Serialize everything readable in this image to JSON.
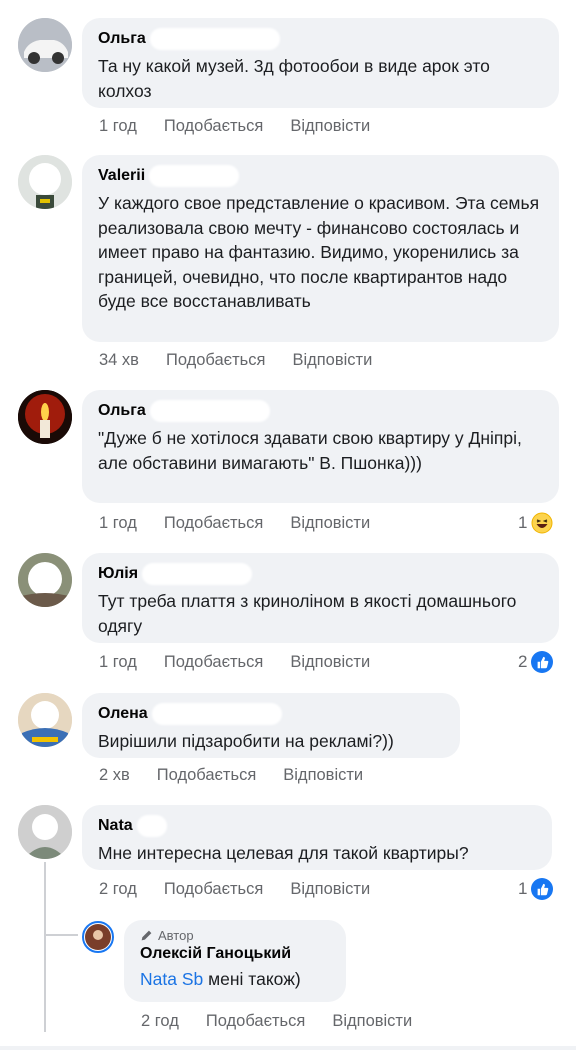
{
  "comments": [
    {
      "author": "Ольга",
      "text": "Та ну какой музей. 3д фотообои в виде арок это колхоз",
      "time": "1 год",
      "like_label": "Подобається",
      "reply_label": "Відповісти"
    },
    {
      "author": "Valerii",
      "text": "У каждого свое представление о красивом. Эта семья реализовала свою мечту - финансово состоялась и имеет право на фантазию. Видимо, укоренились за границей, очевидно, что после квартирантов надо буде все восстанавливать",
      "time": "34 хв",
      "like_label": "Подобається",
      "reply_label": "Відповісти"
    },
    {
      "author": "Ольга",
      "text": "\"Дуже б не хотілося здавати свою квартиру у Дніпрі, але обставини вимагають\" В. Пшонка)))",
      "time": "1 год",
      "like_label": "Подобається",
      "reply_label": "Відповісти",
      "reaction_count": "1",
      "reaction_icon": "haha-icon"
    },
    {
      "author": "Юлія",
      "text": "Тут треба плаття з криноліном в якості домашнього одягу",
      "time": "1 год",
      "like_label": "Подобається",
      "reply_label": "Відповісти",
      "reaction_count": "2",
      "reaction_icon": "like-icon"
    },
    {
      "author": "Олена",
      "text": "Вирішили підзаробити на рекламі?))",
      "time": "2 хв",
      "like_label": "Подобається",
      "reply_label": "Відповісти"
    },
    {
      "author": "Nata",
      "text": "Мне интересна целевая для такой квартиры?",
      "time": "2 год",
      "like_label": "Подобається",
      "reply_label": "Відповісти",
      "reaction_count": "1",
      "reaction_icon": "like-icon"
    }
  ],
  "reply": {
    "badge": "Автор",
    "author": "Олексій Ганоцький",
    "mention": "Nata Sb",
    "text": " мені також)",
    "time": "2 год",
    "like_label": "Подобається",
    "reply_label": "Відповісти"
  },
  "colors": {
    "bubble": "#f0f2f5",
    "meta_text": "#65676b",
    "link": "#1b74e4",
    "like_blue": "#1877f2"
  }
}
